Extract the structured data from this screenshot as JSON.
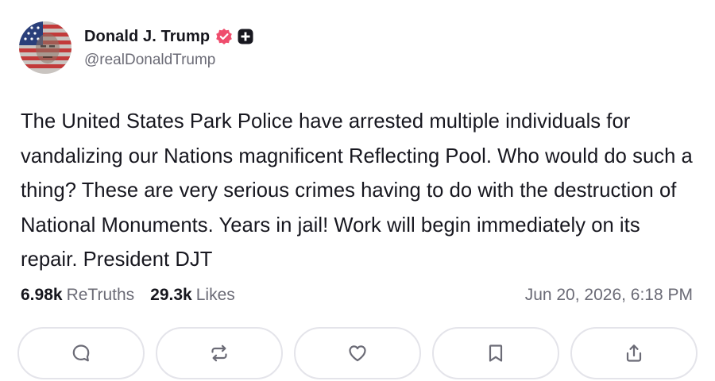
{
  "author": {
    "display_name": "Donald J. Trump",
    "handle": "@realDonaldTrump",
    "verified_color": "#ef4d6d"
  },
  "post": {
    "text": "The United States Park Police have arrested multiple individuals for vandalizing our Nations magnificent Reflecting Pool. Who would do such a thing? These are very serious crimes having to do with the destruction of National Monuments. Years in jail! Work will begin immediately on its repair. President DJT"
  },
  "stats": {
    "retruths_count": "6.98k",
    "retruths_label": "ReTruths",
    "likes_count": "29.3k",
    "likes_label": "Likes",
    "timestamp": "Jun 20, 2026, 6:18 PM"
  },
  "actions": [
    {
      "icon": "reply-icon"
    },
    {
      "icon": "retruth-icon"
    },
    {
      "icon": "like-icon"
    },
    {
      "icon": "bookmark-icon"
    },
    {
      "icon": "share-icon"
    }
  ],
  "colors": {
    "accent": "#ef4d6d",
    "muted_text": "#6b6b76",
    "border": "#e4e4ea"
  }
}
